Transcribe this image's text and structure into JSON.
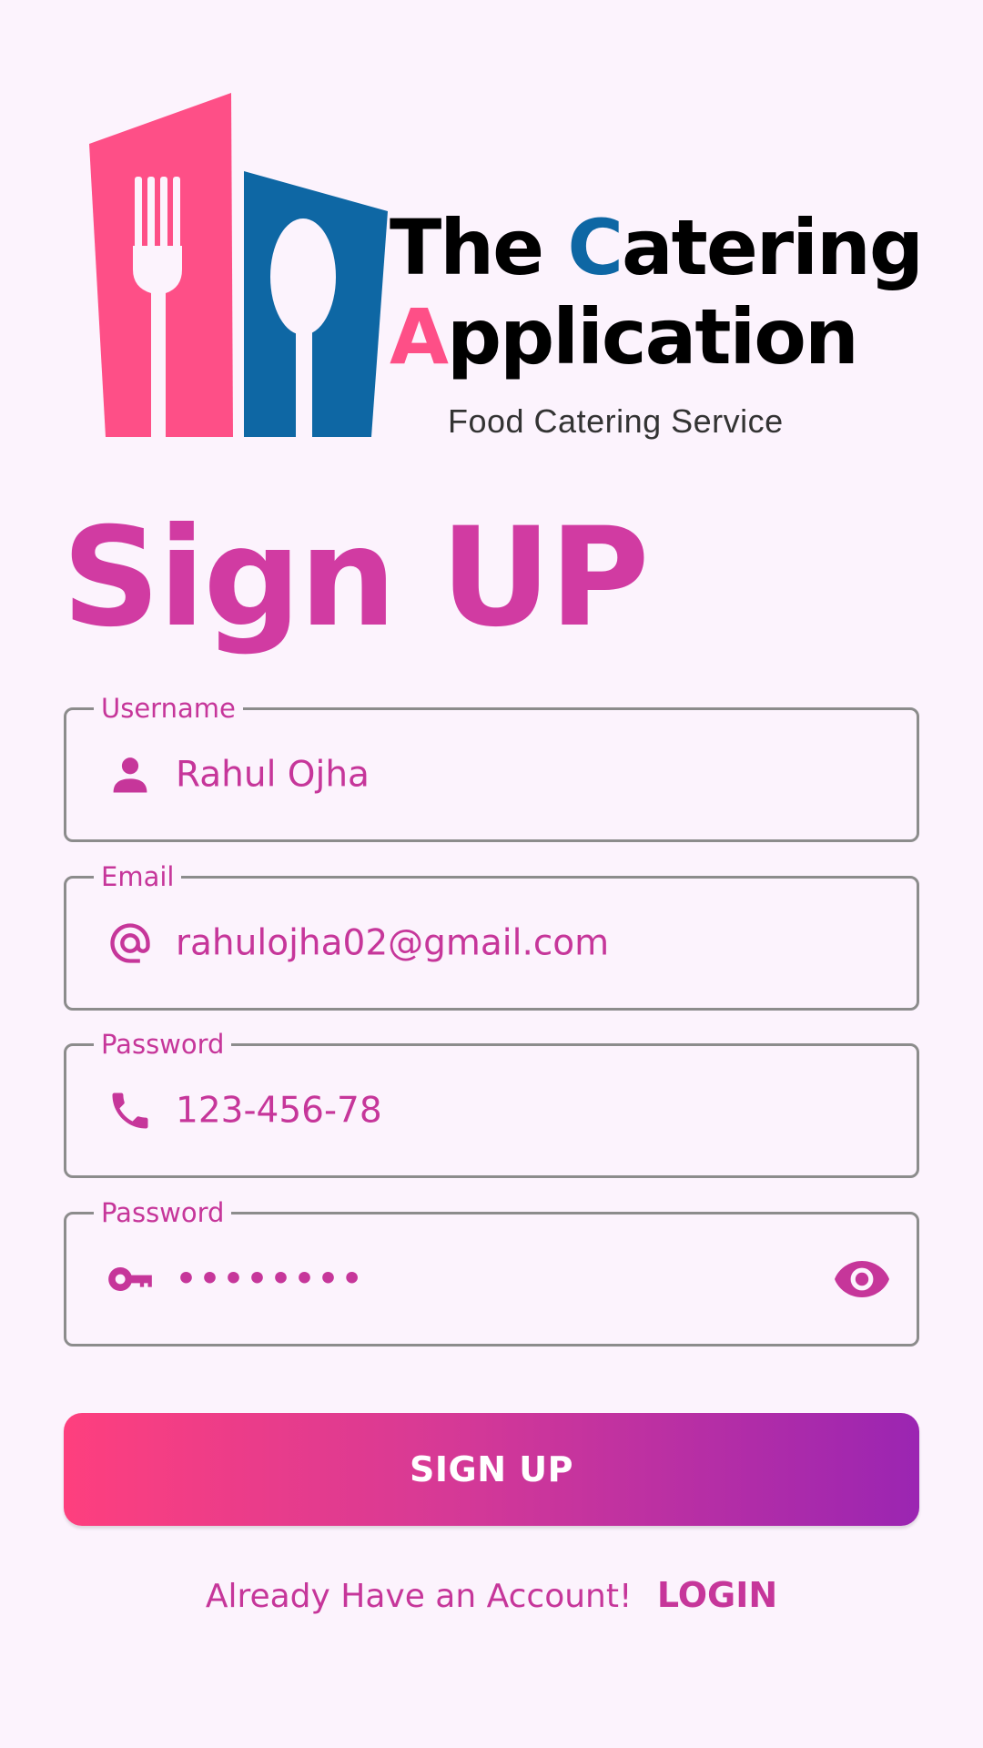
{
  "logo": {
    "line1_prefix": "The ",
    "line1_accent": "C",
    "line1_suffix": "atering",
    "line2_accent": "A",
    "line2_suffix": "pplication",
    "tagline": "Food Catering Service"
  },
  "heading": "Sign UP",
  "fields": {
    "username": {
      "label": "Username",
      "value": "Rahul Ojha",
      "icon": "person-icon"
    },
    "email": {
      "label": "Email",
      "value": "rahulojha02@gmail.com",
      "icon": "at-sign-icon"
    },
    "phone": {
      "label": "Password",
      "value": "123-456-78",
      "icon": "phone-icon"
    },
    "password": {
      "label": "Password",
      "value": "••••••••",
      "icon": "key-icon",
      "toggle_icon": "eye-icon"
    }
  },
  "signup_button": "SIGN UP",
  "footer": {
    "prompt": "Already Have an Account!",
    "link": "LOGIN"
  },
  "colors": {
    "background": "#FCF3FD",
    "accent": "#C6369A",
    "heading": "#D13BA2",
    "gradient_start": "#FE3F7E",
    "gradient_end": "#9B25B2",
    "logo_pink": "#FE4F87",
    "logo_blue": "#0E67A4"
  }
}
